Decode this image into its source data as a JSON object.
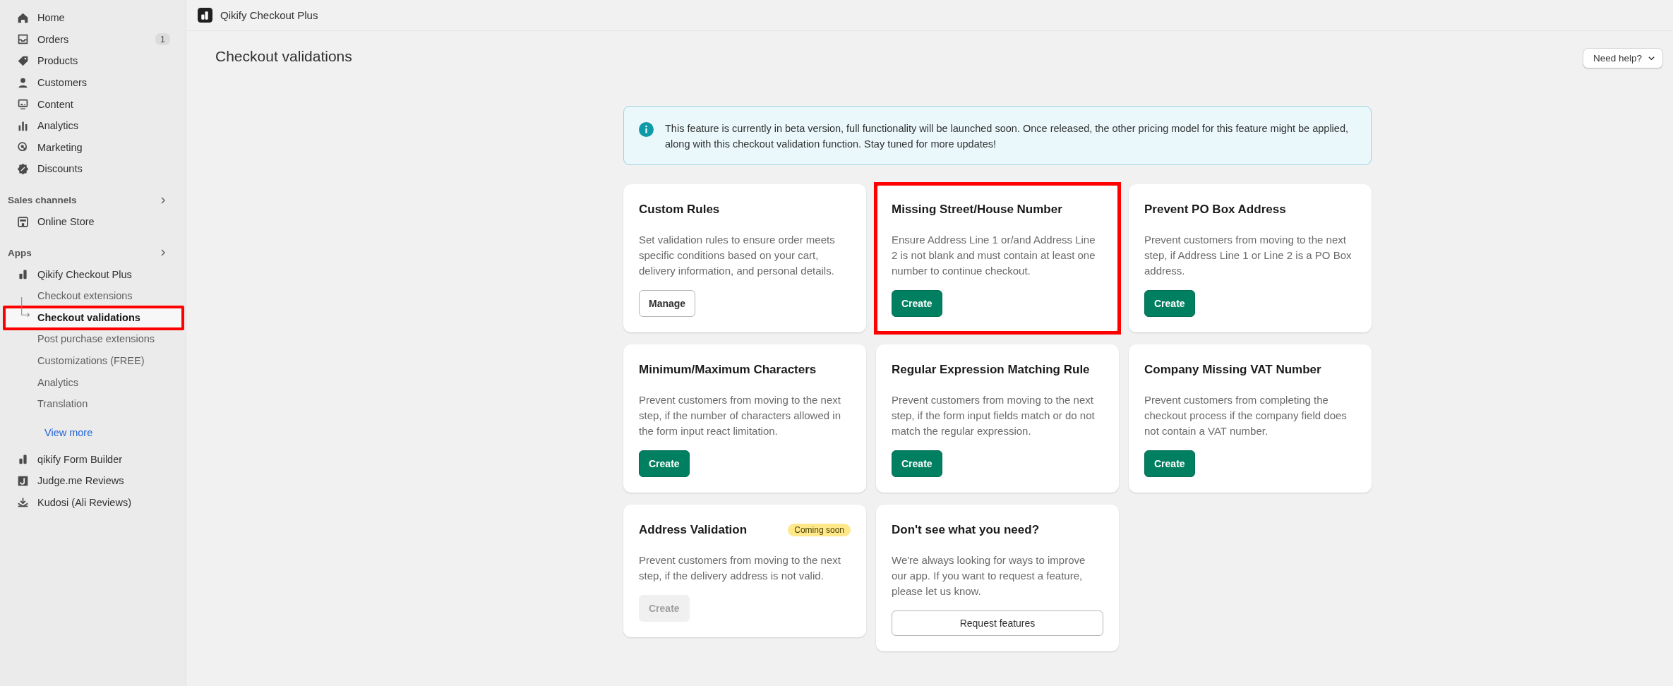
{
  "sidebar": {
    "items": [
      {
        "label": "Home",
        "kind": "home"
      },
      {
        "label": "Orders",
        "kind": "orders",
        "badge": "1"
      },
      {
        "label": "Products",
        "kind": "tag"
      },
      {
        "label": "Customers",
        "kind": "person"
      },
      {
        "label": "Content",
        "kind": "content"
      },
      {
        "label": "Analytics",
        "kind": "chart"
      },
      {
        "label": "Marketing",
        "kind": "target"
      },
      {
        "label": "Discounts",
        "kind": "discount"
      }
    ],
    "sections": [
      {
        "title": "Sales channels",
        "items": [
          {
            "label": "Online Store",
            "kind": "store"
          }
        ]
      },
      {
        "title": "Apps",
        "apps": [
          {
            "label": "Qikify Checkout Plus",
            "kind": "app",
            "expanded": true,
            "children": [
              {
                "label": "Checkout extensions",
                "selected": false,
                "highlighted": false
              },
              {
                "label": "Checkout validations",
                "selected": true,
                "highlighted": true
              },
              {
                "label": "Post purchase extensions",
                "selected": false,
                "highlighted": false
              },
              {
                "label": "Customizations (FREE)",
                "selected": false,
                "highlighted": false
              },
              {
                "label": "Analytics",
                "selected": false,
                "highlighted": false
              },
              {
                "label": "Translation",
                "selected": false,
                "highlighted": false
              }
            ],
            "more_link": "View more"
          },
          {
            "label": "qikify Form Builder",
            "kind": "app",
            "expanded": false
          },
          {
            "label": "Judge.me Reviews",
            "kind": "judge",
            "expanded": false
          },
          {
            "label": "Kudosi (Ali Reviews)",
            "kind": "download",
            "expanded": false
          }
        ]
      }
    ]
  },
  "topbar": {
    "app_name": "Qikify Checkout Plus"
  },
  "page": {
    "title": "Checkout validations",
    "help_button": "Need help?"
  },
  "banner": {
    "text": "This feature is currently in beta version, full functionality will be launched soon. Once released, the other pricing model for this feature might be applied, along with this checkout validation function. Stay tuned for more updates!"
  },
  "cards": [
    {
      "title": "Custom Rules",
      "description": "Set validation rules to ensure order meets specific conditions based on your cart, delivery information, and personal details.",
      "button": {
        "label": "Manage",
        "kind": "secondary",
        "disabled": false
      },
      "highlighted": false
    },
    {
      "title": "Missing Street/House Number",
      "description": "Ensure Address Line 1 or/and Address Line 2 is not blank and must contain at least one number to continue checkout.",
      "button": {
        "label": "Create",
        "kind": "primary",
        "disabled": false
      },
      "highlighted": true
    },
    {
      "title": "Prevent PO Box Address",
      "description": "Prevent customers from moving to the next step, if Address Line 1 or Line 2 is a PO Box address.",
      "button": {
        "label": "Create",
        "kind": "primary",
        "disabled": false
      },
      "highlighted": false
    },
    {
      "title": "Minimum/Maximum Characters",
      "description": "Prevent customers from moving to the next step, if the number of characters allowed in the form input react limitation.",
      "button": {
        "label": "Create",
        "kind": "primary",
        "disabled": false
      },
      "highlighted": false
    },
    {
      "title": "Regular Expression Matching Rule",
      "description": "Prevent customers from moving to the next step, if the form input fields match or do not match the regular expression.",
      "button": {
        "label": "Create",
        "kind": "primary",
        "disabled": false
      },
      "highlighted": false
    },
    {
      "title": "Company Missing VAT Number",
      "description": "Prevent customers from completing the checkout process if the company field does not contain a VAT number.",
      "button": {
        "label": "Create",
        "kind": "primary",
        "disabled": false
      },
      "highlighted": false
    },
    {
      "title": "Address Validation",
      "badge": "Coming soon",
      "description": "Prevent customers from moving to the next step, if the delivery address is not valid.",
      "button": {
        "label": "Create",
        "kind": "primary",
        "disabled": true
      },
      "highlighted": false
    },
    {
      "title": "Don't see what you need?",
      "description": "We're always looking for ways to improve our app. If you want to request a feature, please let us know.",
      "button": {
        "label": "Request features",
        "kind": "wide",
        "disabled": false
      },
      "highlighted": false
    }
  ]
}
